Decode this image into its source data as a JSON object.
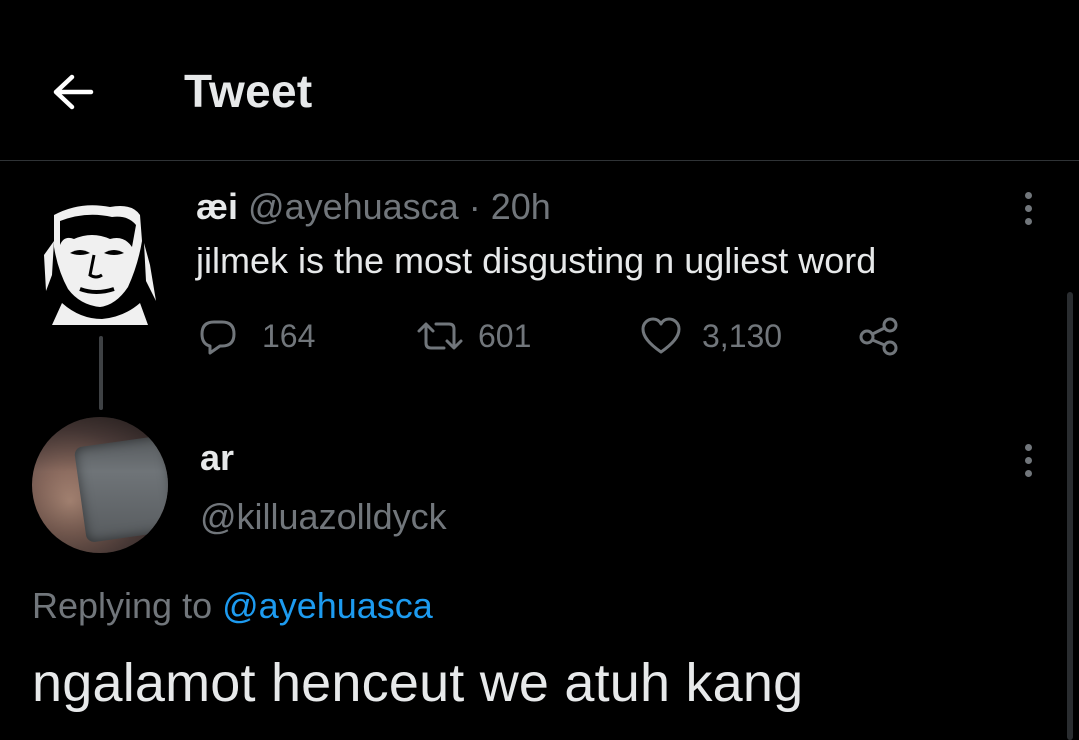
{
  "header": {
    "title": "Tweet",
    "back_icon": "arrow-left-icon"
  },
  "parent_tweet": {
    "display_name": "æi",
    "handle": "@ayehuasca",
    "separator": "·",
    "time": "20h",
    "text": "jilmek is the most disgusting n ugliest word",
    "stats": {
      "replies": "164",
      "retweets": "601",
      "likes": "3,130"
    },
    "icons": [
      "reply-icon",
      "retweet-icon",
      "like-icon",
      "share-icon",
      "more-icon"
    ]
  },
  "reply_tweet": {
    "display_name": "ar",
    "handle": "@killuazolldyck",
    "replying_prefix": "Replying to",
    "replying_to": "@ayehuasca",
    "text": "ngalamot henceut we atuh kang"
  },
  "colors": {
    "background": "#000000",
    "text": "#e7e9ea",
    "muted": "#71767b",
    "link": "#1d9bf0",
    "divider": "#2f3336"
  }
}
